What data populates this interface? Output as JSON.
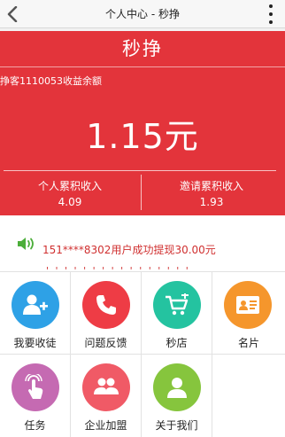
{
  "header": {
    "title": "个人中心 - 秒挣",
    "back_icon": "back-chevron-icon",
    "menu_icon": "more-vertical-icon"
  },
  "hero": {
    "app_name": "秒挣",
    "balance_label": "挣客1110053收益余额",
    "balance_value": "1.15元",
    "personal_total_label": "个人累积收入",
    "personal_total_value": "4.09",
    "invite_total_label": "邀请累积收入",
    "invite_total_value": "1.93",
    "background_color": "#e3343b"
  },
  "notice": {
    "icon": "speaker-icon",
    "text": "151****8302用户成功提现30.00元",
    "text_color": "#d03030"
  },
  "menu": {
    "items": [
      {
        "label": "我要收徒",
        "icon": "add-user-icon",
        "color": "#2ea1e6"
      },
      {
        "label": "问题反馈",
        "icon": "phone-icon",
        "color": "#ee3c45"
      },
      {
        "label": "秒店",
        "icon": "cart-icon",
        "color": "#24c3a0"
      },
      {
        "label": "名片",
        "icon": "card-icon",
        "color": "#f5962c"
      },
      {
        "label": "任务",
        "icon": "touch-icon",
        "color": "#c56ab2"
      },
      {
        "label": "企业加盟",
        "icon": "group-icon",
        "color": "#f05a66"
      },
      {
        "label": "关于我们",
        "icon": "person-icon",
        "color": "#86c53d"
      }
    ]
  }
}
